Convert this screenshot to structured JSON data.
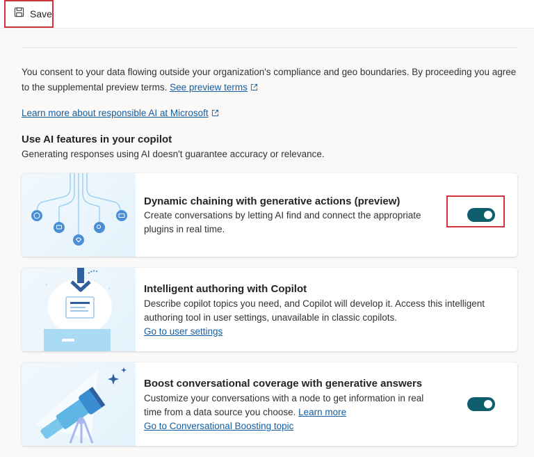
{
  "toolbar": {
    "save_label": "Save"
  },
  "consent": {
    "text": "You consent to your data flowing outside your organization's compliance and geo boundaries. By proceeding you agree to the supplemental preview terms.",
    "terms_link": "See preview terms"
  },
  "learn_more_link": "Learn more about responsible AI at Microsoft",
  "section": {
    "title": "Use AI features in your copilot",
    "subtitle": "Generating responses using AI doesn't guarantee accuracy or relevance."
  },
  "cards": [
    {
      "title": "Dynamic chaining with generative actions (preview)",
      "description": "Create conversations by letting AI find and connect the appropriate plugins in real time.",
      "toggle_on": true
    },
    {
      "title": "Intelligent authoring with Copilot",
      "description": "Describe copilot topics you need, and Copilot will develop it. Access this intelligent authoring tool in user settings, unavailable in classic copilots.",
      "link": "Go to user settings"
    },
    {
      "title": "Boost conversational coverage with generative answers",
      "description": "Customize your conversations with a node to get information in real time from a data source you choose.",
      "inline_link": "Learn more",
      "link": "Go to Conversational Boosting topic",
      "toggle_on": true
    }
  ],
  "colors": {
    "toggle_on": "#0f5e6e",
    "link": "#115ea3",
    "highlight": "#d13438"
  }
}
